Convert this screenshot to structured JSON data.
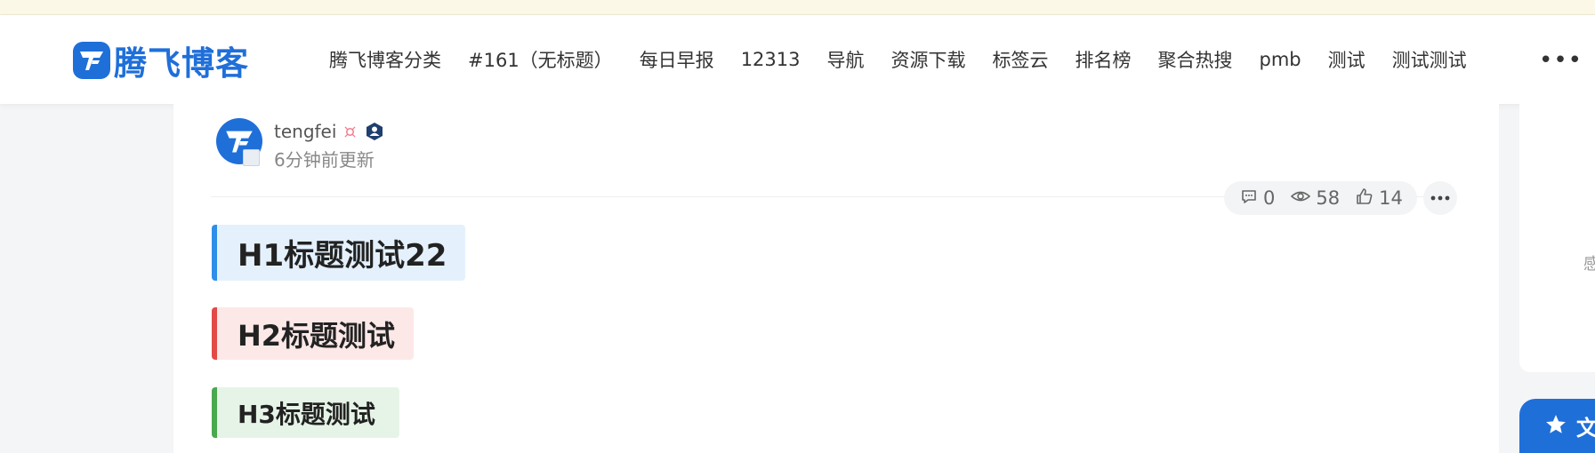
{
  "site": {
    "logo_text": "腾飞博客"
  },
  "nav": {
    "items": [
      "腾飞博客分类",
      "#161（无标题）",
      "每日早报",
      "12313",
      "导航",
      "资源下载",
      "标签云",
      "排名榜",
      "聚合热搜",
      "pmb",
      "测试",
      "测试测试"
    ],
    "more": "•••"
  },
  "post": {
    "author": "tengfei",
    "updated": "6分钟前更新",
    "stats": {
      "comments": "0",
      "views": "58",
      "likes": "14"
    },
    "headings": {
      "h1": "H1标题测试22",
      "h2": "H2标题测试",
      "h3": "H3标题测试"
    }
  },
  "sidebar": {
    "faint_text": "感",
    "button_label": "文"
  },
  "colors": {
    "brand": "#1f6fd9",
    "h1_accent": "#2f8ee8",
    "h2_accent": "#e34a45",
    "h3_accent": "#4aa84f"
  },
  "icons": [
    "logo-icon",
    "gender-icon",
    "vip-badge-icon",
    "comment-icon",
    "eye-icon",
    "thumbs-up-icon",
    "more-icon",
    "star-icon"
  ]
}
